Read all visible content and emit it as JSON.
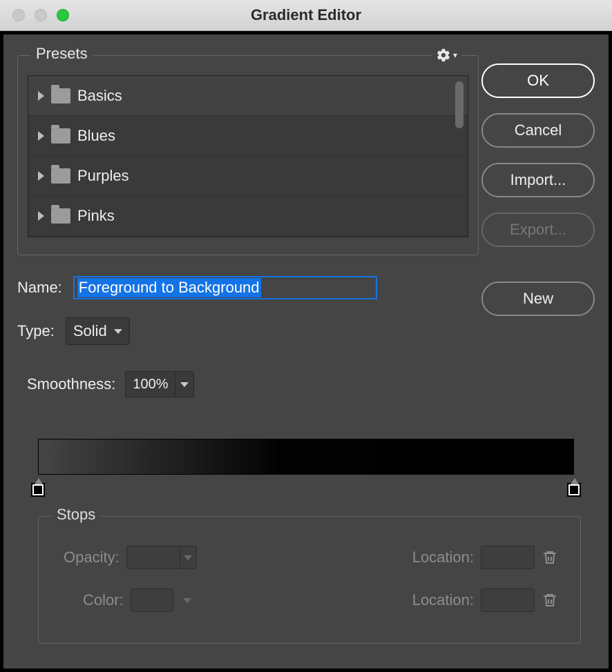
{
  "window": {
    "title": "Gradient Editor"
  },
  "presets": {
    "legend": "Presets",
    "items": [
      {
        "label": "Basics"
      },
      {
        "label": "Blues"
      },
      {
        "label": "Purples"
      },
      {
        "label": "Pinks"
      }
    ]
  },
  "buttons": {
    "ok": "OK",
    "cancel": "Cancel",
    "import": "Import...",
    "export": "Export...",
    "new": "New"
  },
  "name": {
    "label": "Name:",
    "value": "Foreground to Background"
  },
  "type": {
    "label": "Type:",
    "value": "Solid"
  },
  "smoothness": {
    "label": "Smoothness:",
    "value": "100%"
  },
  "stops": {
    "legend": "Stops",
    "opacity_label": "Opacity:",
    "color_label": "Color:",
    "location_label": "Location:"
  }
}
